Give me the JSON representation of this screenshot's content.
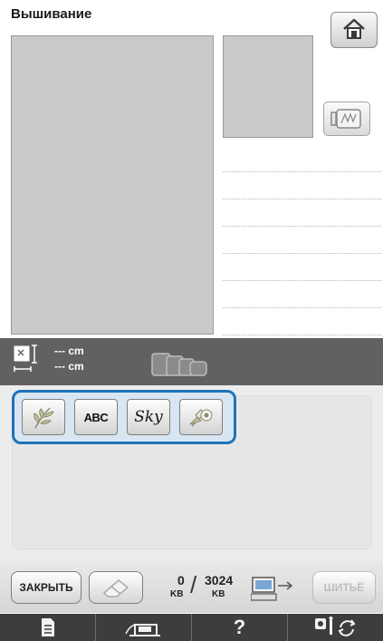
{
  "header": {
    "title": "Вышивание"
  },
  "size": {
    "width": "--- cm",
    "height": "--- cm"
  },
  "categories": [
    {
      "name": "floral-pattern",
      "label": ""
    },
    {
      "name": "alphabet",
      "label": "ABC"
    },
    {
      "name": "script-font",
      "label": "Sky"
    },
    {
      "name": "embroidery-card",
      "label": ""
    }
  ],
  "controls": {
    "close_label": "ЗАКРЫТЬ",
    "sew_label": "ШИТЬЁ"
  },
  "memory": {
    "used": "0",
    "used_unit": "KB",
    "total": "3024",
    "total_unit": "KB"
  },
  "nav": {
    "help_label": "?"
  },
  "colors": {
    "accent": "#1f73b8",
    "panel_dark": "#616161",
    "preview_gray": "#cacaca"
  }
}
